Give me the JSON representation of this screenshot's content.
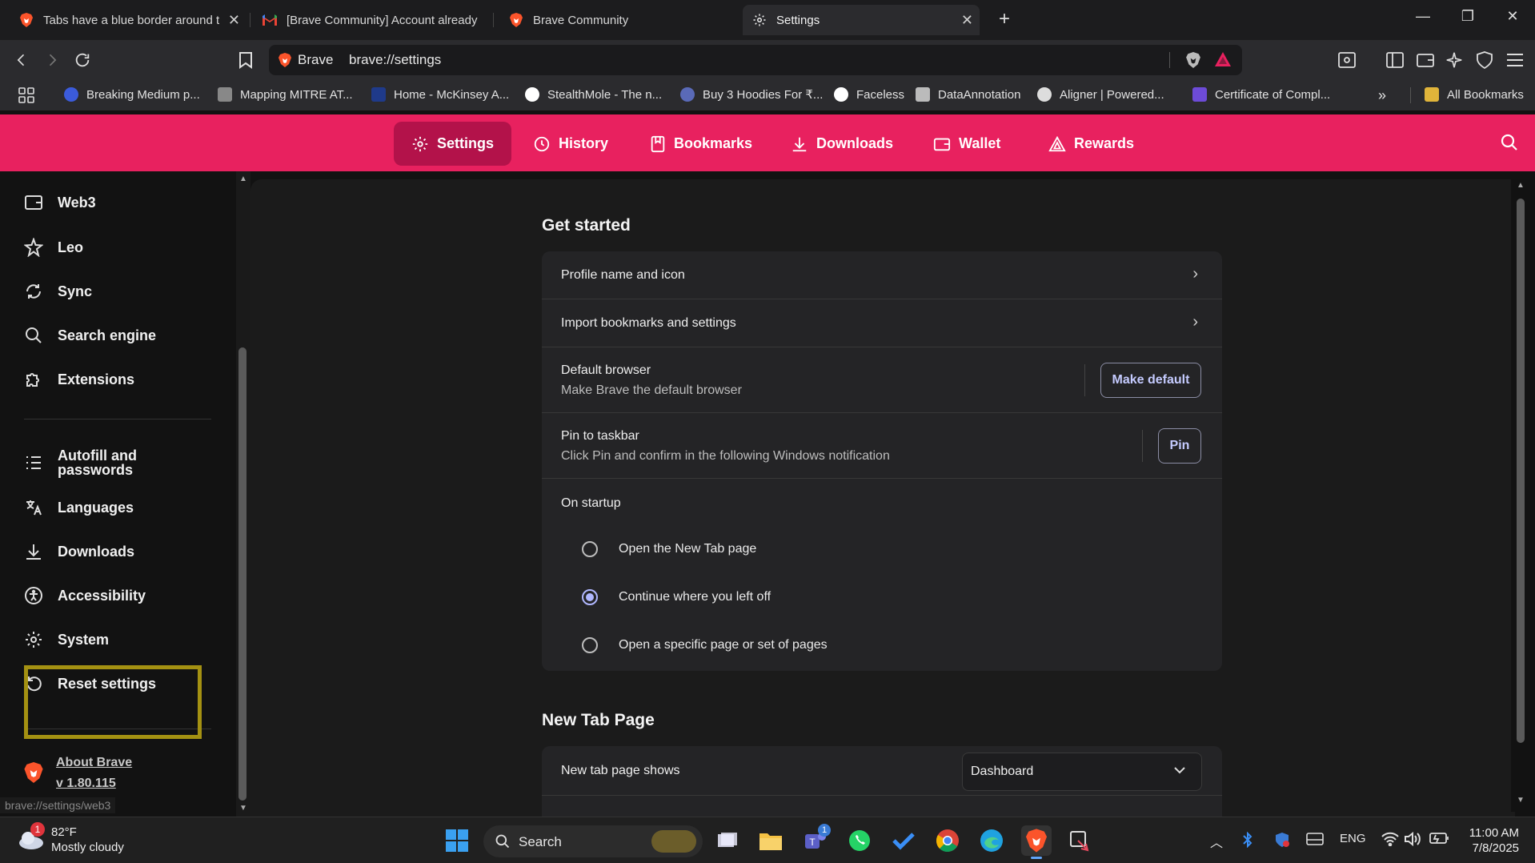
{
  "tabs": [
    {
      "title": "Tabs have a blue border around t",
      "favicon": "brave-lion-icon"
    },
    {
      "title": "[Brave Community] Account already c",
      "favicon": "gmail-icon"
    },
    {
      "title": "Brave Community",
      "favicon": "brave-lion-icon"
    },
    {
      "title": "Settings",
      "favicon": "gear-icon",
      "active": true
    }
  ],
  "toolbar": {
    "site_name": "Brave",
    "url": "brave://settings"
  },
  "bookmarks": [
    {
      "label": "Breaking Medium p...",
      "color": "#3b5bdb"
    },
    {
      "label": "Mapping MITRE AT...",
      "color": "#888888"
    },
    {
      "label": "Home - McKinsey A...",
      "color": "#1f3a8a"
    },
    {
      "label": "StealthMole - The n...",
      "color": "#ffffff"
    },
    {
      "label": "Buy 3 Hoodies For ₹...",
      "color": "#5a6ab8"
    },
    {
      "label": "Faceless",
      "color": "#ffffff"
    },
    {
      "label": "DataAnnotation",
      "color": "#bbbbbb"
    },
    {
      "label": "Aligner | Powered...",
      "color": "#dddddd"
    },
    {
      "label": "Certificate of Compl...",
      "color": "#6d4bd8"
    },
    {
      "label": "All Bookmarks",
      "color": "#e0b43a"
    }
  ],
  "header": {
    "nav": [
      "Settings",
      "History",
      "Bookmarks",
      "Downloads",
      "Wallet",
      "Rewards"
    ]
  },
  "sidebar": {
    "items": [
      "Web3",
      "Leo",
      "Sync",
      "Search engine",
      "Extensions",
      "Autofill and passwords",
      "Languages",
      "Downloads",
      "Accessibility",
      "System",
      "Reset settings"
    ],
    "about": "About Brave",
    "version": "v 1.80.115",
    "status_url": "brave://settings/web3"
  },
  "main": {
    "get_started_title": "Get started",
    "profile_name": "Profile name and icon",
    "import_bookmarks": "Import bookmarks and settings",
    "default_browser": {
      "label": "Default browser",
      "sub": "Make Brave the default browser",
      "button": "Make default"
    },
    "pin_taskbar": {
      "label": "Pin to taskbar",
      "sub": "Click Pin and confirm in the following Windows notification",
      "button": "Pin"
    },
    "on_startup": {
      "label": "On startup",
      "options": [
        "Open the New Tab page",
        "Continue where you left off",
        "Open a specific page or set of pages"
      ],
      "selected": 1
    },
    "new_tab_title": "New Tab Page",
    "new_tab_shows": {
      "label": "New tab page shows",
      "value": "Dashboard"
    }
  },
  "taskbar": {
    "temperature": "82°F",
    "weather": "Mostly cloudy",
    "weather_badge": "1",
    "search": "Search",
    "teams_badge": "1",
    "lang": "ENG",
    "time": "11:00 AM",
    "date": "7/8/2025"
  },
  "colors": {
    "header": "#e8215f",
    "active_nav": "#b3124a",
    "highlight": "#a49112",
    "accent": "#b0b7ff"
  }
}
